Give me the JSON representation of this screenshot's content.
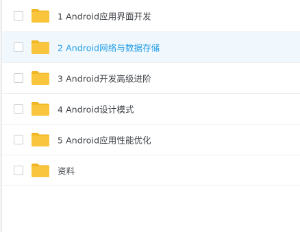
{
  "file_list": {
    "items": [
      {
        "name": "1 Android应用界面开发",
        "icon": "folder-icon",
        "active": false
      },
      {
        "name": "2 Android网络与数据存储",
        "icon": "folder-icon",
        "active": true
      },
      {
        "name": "3 Android开发高级进阶",
        "icon": "folder-icon",
        "active": false
      },
      {
        "name": "4 Android设计模式",
        "icon": "folder-icon",
        "active": false
      },
      {
        "name": "5 Android应用性能优化",
        "icon": "folder-icon",
        "active": false
      },
      {
        "name": "资料",
        "icon": "folder-icon",
        "active": false
      }
    ]
  },
  "colors": {
    "folder": "#f8c53c",
    "folder_tab": "#f0b624",
    "active_text": "#1e9be6",
    "active_row_bg": "#f0f8fd",
    "text": "#3b3f44"
  }
}
